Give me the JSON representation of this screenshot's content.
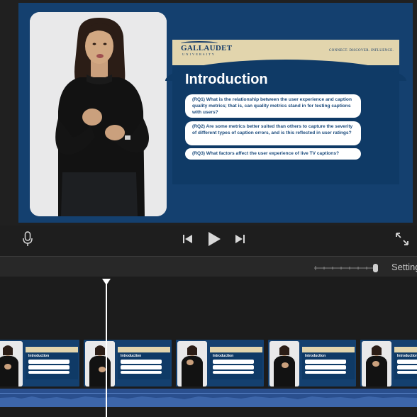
{
  "slide": {
    "logo": "GALLAUDET",
    "logo_sub": "UNIVERSITY",
    "tagline": "CONNECT. DISCOVER. INFLUENCE.",
    "title": "Introduction",
    "rq1": "(RQ1) What is the relationship between the user experience and caption quality metrics; that is, can quality metrics stand in for testing captions with users?",
    "rq2": "(RQ2) Are some metrics better suited than others to capture the severity of different types of caption errors, and is this reflected in user ratings?",
    "rq3": "(RQ3) What factors affect the user experience of live TV captions?"
  },
  "controls": {
    "mic_icon": "microphone-icon",
    "prev_icon": "skip-back-icon",
    "play_icon": "play-icon",
    "next_icon": "skip-forward-icon",
    "expand_icon": "fullscreen-icon"
  },
  "toolbar": {
    "settings_label": "Settings"
  },
  "timeline": {
    "clip_count": 5,
    "clip_title": "Introduction"
  },
  "colors": {
    "slide_blue": "#14406f",
    "header_tan": "#e2d5ad",
    "audio_blue": "#2a4f8e",
    "background": "#1e1e1e"
  }
}
